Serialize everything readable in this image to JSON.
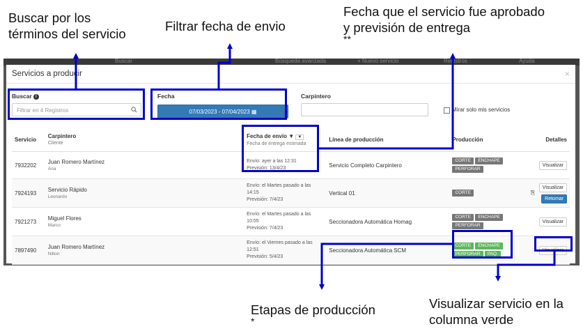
{
  "annotations": {
    "search": [
      "Buscar por los",
      "términos del servicio"
    ],
    "date_filter": "Filtrar fecha de envio",
    "approved": [
      "Fecha que el servicio fue aprobado",
      "y previsión de entrega",
      "**"
    ],
    "stages": [
      "Etapas de producción",
      "*"
    ],
    "view": [
      "Visualizar servicio en la",
      "columna verde"
    ]
  },
  "background": {
    "bar_left": "Buscar",
    "bar_mid": "Búsqueda avanzada",
    "bar_new": "+ Nuevo servicio",
    "bar_reg": "Registros",
    "bar_right": "Ayuda"
  },
  "modal": {
    "title": "Servicios a producir",
    "close": "×",
    "buscar_label": "Buscar",
    "buscar_placeholder": "Filtrar en 4 Registros",
    "fecha_label": "Fecha",
    "date_range": "07/03/2023 - 07/04/2023",
    "carpintero_label": "Carpintero",
    "mostrar_label": "Mirar solo mis servicios"
  },
  "table": {
    "headers": {
      "servicio": "Servicio",
      "carpintero": "Carpintero",
      "carpintero_sub": "Cliente",
      "fecha": "Fecha de envío",
      "fecha_sub": "Fecha de entrega estimada",
      "linea": "Línea de producción",
      "produccion": "Producción",
      "detalles": "Detalles"
    },
    "rows": [
      {
        "id": "7932202",
        "carpintero": "Juan Romero Martínez",
        "cliente": "Ana",
        "envio": "Envío: ayer a las 12:31",
        "prevision": "Previsión: 13/4/23",
        "linea": "Servicio Completo Carpintero",
        "tags": [
          "CORTE",
          "ENCHAPE",
          "PERFORAR"
        ],
        "btn": "Visualizar"
      },
      {
        "id": "7924193",
        "carpintero": "Servicio Rápido",
        "cliente": "Leonardo",
        "envio": "Envío: el Martes pasado a las 14:15",
        "prevision": "Previsión: 7/4/23",
        "linea": "Vertical 01",
        "tags": [
          "CORTE"
        ],
        "btn": "Visualizar",
        "btn2": "Retomar"
      },
      {
        "id": "7921273",
        "carpintero": "Miguel Flores",
        "cliente": "Marco",
        "envio": "Envío: el Martes pasado a las 10:55",
        "prevision": "Previsión: 7/4/23",
        "linea": "Seccionadora Automática Homag",
        "tags": [
          "CORTE",
          "ENCHAPE",
          "PERFORAR"
        ],
        "btn": "Visualizar"
      },
      {
        "id": "7897490",
        "carpintero": "Juan Romero Martínez",
        "cliente": "Nilton",
        "envio": "Envío: el Viernes pasado a las 12:51",
        "prevision": "Previsión: 5/4/23",
        "linea": "Seccionadora Automática SCM",
        "tags": [
          "CORTE",
          "ENCHAPE",
          "PERFORAR",
          "PAQ."
        ],
        "btn": "Visualizar"
      }
    ]
  },
  "colors": {
    "annotation_blue": "#0000cc",
    "primary": "#337ab7",
    "success": "#5cb85c",
    "tag_gray": "#777777"
  }
}
